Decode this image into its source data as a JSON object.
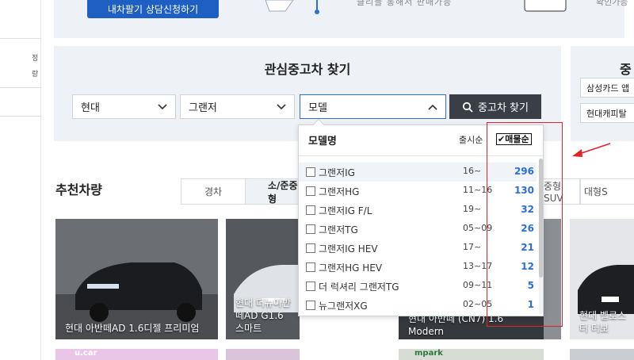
{
  "left_strip": {
    "lines": [
      "정",
      "랑"
    ]
  },
  "banner": {
    "consult_button": "내차팔기 상담신청하기",
    "text_mid": "클리블 통해서 판매가능",
    "text_right": "확인가능"
  },
  "search": {
    "title": "관심중고차 찾기",
    "maker_value": "현대",
    "model_group_value": "그랜저",
    "model_value": "모델",
    "find_button": "중고차 찾기"
  },
  "right_panel": {
    "title": "중",
    "items": [
      "삼성카드 앱",
      "현대캐피탈"
    ]
  },
  "dropdown": {
    "header": "모델명",
    "sort_release": "출시순",
    "sort_count": "매물순",
    "rows": [
      {
        "name": "그랜저IG",
        "year": "16~",
        "count": "296"
      },
      {
        "name": "그랜저HG",
        "year": "11~16",
        "count": "130"
      },
      {
        "name": "그랜저IG F/L",
        "year": "19~",
        "count": "32"
      },
      {
        "name": "그랜저TG",
        "year": "05~09",
        "count": "26"
      },
      {
        "name": "그랜저IG HEV",
        "year": "17~",
        "count": "21"
      },
      {
        "name": "그랜저HG HEV",
        "year": "13~17",
        "count": "12"
      },
      {
        "name": "더 럭셔리 그랜저TG",
        "year": "09~11",
        "count": "5"
      },
      {
        "name": "뉴그랜저XG",
        "year": "02~05",
        "count": "1"
      }
    ]
  },
  "recommend": {
    "title": "추천차량",
    "tabs": [
      "경차",
      "소/준중형",
      "중형SUV",
      "대형S"
    ],
    "cars": [
      {
        "caption": "현대 아반떼AD 1.6디젤 프리미엄"
      },
      {
        "caption": "현대 더뉴아반떼AD G1.6 스마트"
      },
      {
        "caption": "현대 아반떼 (CN7) 1.6 Modern"
      },
      {
        "caption": "현대 벨로스터 터보"
      }
    ],
    "bottom_labels": [
      "u.car",
      "mpark"
    ]
  },
  "colors": {
    "accent_blue": "#2b6fd6",
    "button_dark": "#3a3f47",
    "panel_bg": "#eef1f6",
    "annotation_red": "#e0222b"
  }
}
